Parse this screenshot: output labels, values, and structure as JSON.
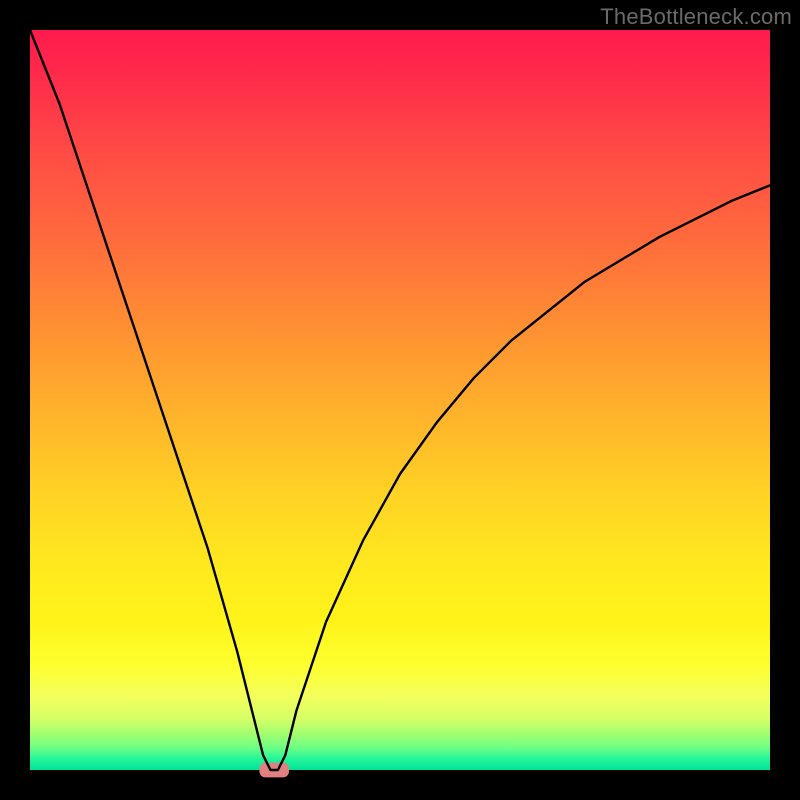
{
  "watermark": "TheBottleneck.com",
  "chart_data": {
    "type": "line",
    "title": "",
    "xlabel": "",
    "ylabel": "",
    "xlim": [
      0,
      100
    ],
    "ylim": [
      0,
      100
    ],
    "grid": false,
    "legend": false,
    "background_gradient": {
      "direction": "vertical",
      "stops": [
        {
          "pos": 0.0,
          "color": "#ff1a4d"
        },
        {
          "pos": 0.35,
          "color": "#ff7a36"
        },
        {
          "pos": 0.65,
          "color": "#ffd324"
        },
        {
          "pos": 0.88,
          "color": "#fdff30"
        },
        {
          "pos": 0.97,
          "color": "#6cff85"
        },
        {
          "pos": 1.0,
          "color": "#00e39a"
        }
      ]
    },
    "series": [
      {
        "name": "bottleneck-curve",
        "color": "#000000",
        "x": [
          0,
          4,
          8,
          12,
          16,
          20,
          24,
          28,
          30,
          31.5,
          32.5,
          33.5,
          34.5,
          36,
          40,
          45,
          50,
          55,
          60,
          65,
          70,
          75,
          80,
          85,
          90,
          95,
          100
        ],
        "y": [
          100,
          90,
          78,
          66,
          54,
          42,
          30,
          16,
          8,
          2,
          0,
          0,
          2,
          8,
          20,
          31,
          40,
          47,
          53,
          58,
          62,
          66,
          69,
          72,
          74.5,
          77,
          79
        ]
      }
    ],
    "marker": {
      "name": "min-point-marker",
      "x": 33,
      "y": 0,
      "width_pct": 4,
      "height_pct": 2,
      "color": "#e08080"
    }
  }
}
